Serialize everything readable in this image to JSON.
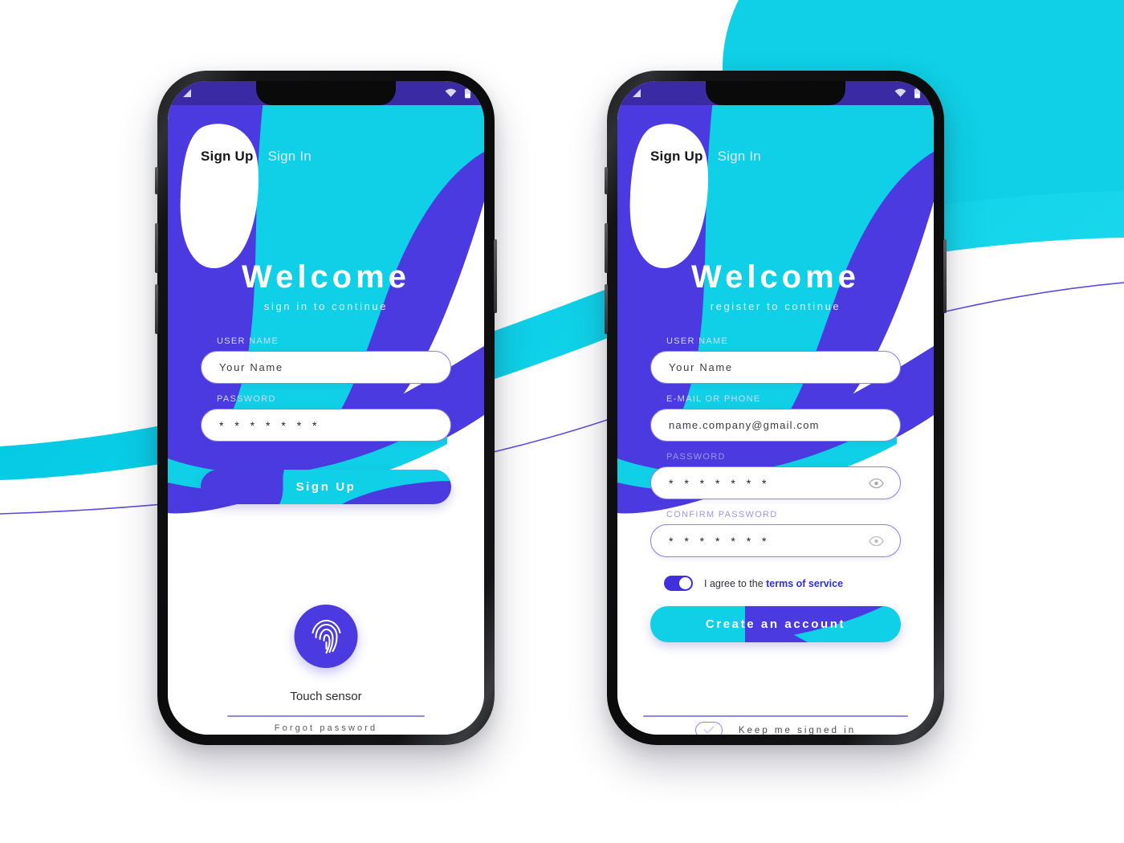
{
  "colors": {
    "indigo": "#4a3ae0",
    "indigo_deep": "#3a2ba4",
    "cyan": "#00cfe8",
    "white": "#ffffff",
    "label_on_white": "#9e96e6",
    "link": "#2f2fd8",
    "divider": "#9086ee"
  },
  "phones": [
    {
      "id": "phone-signin",
      "statusbar": {
        "signal_icon": "signal-triangle-icon",
        "wifi_icon": "wifi-icon",
        "battery_icon": "battery-icon"
      },
      "tabs": [
        {
          "label": "Sign Up",
          "active": true
        },
        {
          "label": "Sign In",
          "active": false
        }
      ],
      "hero": {
        "title": "Welcome",
        "subtitle": "sign in to continue"
      },
      "fields": [
        {
          "label": "USER NAME",
          "value": "Your Name",
          "type": "text",
          "label_on": "art",
          "eye": false
        },
        {
          "label": "PASSWORD",
          "value": "* * * * * * *",
          "type": "password",
          "label_on": "art",
          "eye": false
        }
      ],
      "cta": {
        "label": "Sign Up"
      },
      "sensor": {
        "icon": "fingerprint-icon",
        "label": "Touch sensor"
      },
      "footer_link": "Forgot password"
    },
    {
      "id": "phone-signup",
      "statusbar": {
        "signal_icon": "signal-triangle-icon",
        "wifi_icon": "wifi-icon",
        "battery_icon": "battery-icon"
      },
      "tabs": [
        {
          "label": "Sign Up",
          "active": true
        },
        {
          "label": "Sign In",
          "active": false
        }
      ],
      "hero": {
        "title": "Welcome",
        "subtitle": "register to continue"
      },
      "fields": [
        {
          "label": "USER NAME",
          "value": "Your Name",
          "type": "text",
          "label_on": "art",
          "eye": false
        },
        {
          "label": "E-MAIL OR PHONE",
          "value": "name.company@gmail.com",
          "type": "email",
          "label_on": "art",
          "eye": false
        },
        {
          "label": "PASSWORD",
          "value": "* * * * * * *",
          "type": "password",
          "label_on": "white",
          "eye": true
        },
        {
          "label": "CONFIRM PASSWORD",
          "value": "* * * * * * *",
          "type": "password",
          "label_on": "white",
          "eye": true
        }
      ],
      "agree": {
        "toggle_on": true,
        "text_prefix": "I agree to the ",
        "link_text": "terms of service"
      },
      "cta": {
        "label": "Create an account"
      },
      "keep": {
        "checkbox_icon": "check-icon",
        "label": "Keep me signed in"
      }
    }
  ]
}
